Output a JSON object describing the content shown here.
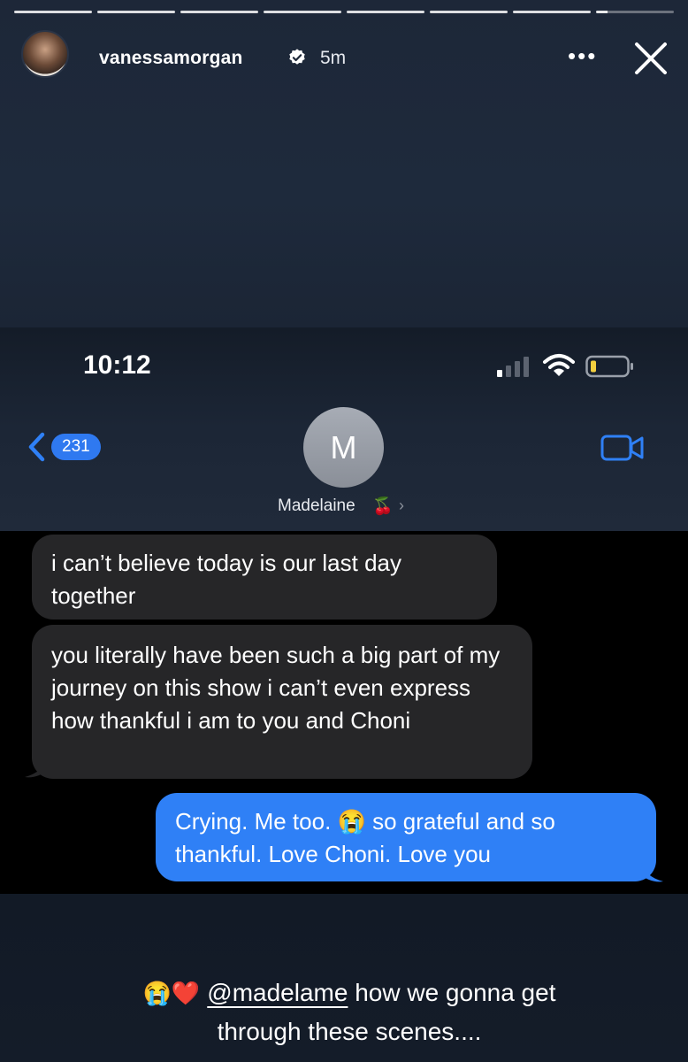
{
  "story": {
    "username": "vanessamorgan",
    "time_ago": "5m",
    "more_label": "•••",
    "progress_segments": 8
  },
  "phone": {
    "clock": "10:12",
    "back_count": "231",
    "contact_initial": "M",
    "contact_name": "Madelaine",
    "contact_emoji": "🍒",
    "contact_chevron": "›"
  },
  "messages": [
    {
      "direction": "incoming",
      "text": "i can’t believe today is our last day together"
    },
    {
      "direction": "incoming",
      "text": "you literally have been such a big part of my journey on this show i can’t even express how thankful i am to you and Choni"
    },
    {
      "direction": "outgoing",
      "text": "Crying. Me too. 😭 so grateful and so thankful. Love Choni. Love you"
    }
  ],
  "caption": {
    "emojis": "😭❤️",
    "mention": "@madelame",
    "text_1": "how we gonna get",
    "text_2": "through these scenes...."
  },
  "colors": {
    "ios_blue": "#2f80f6",
    "incoming_bubble": "#262628"
  }
}
